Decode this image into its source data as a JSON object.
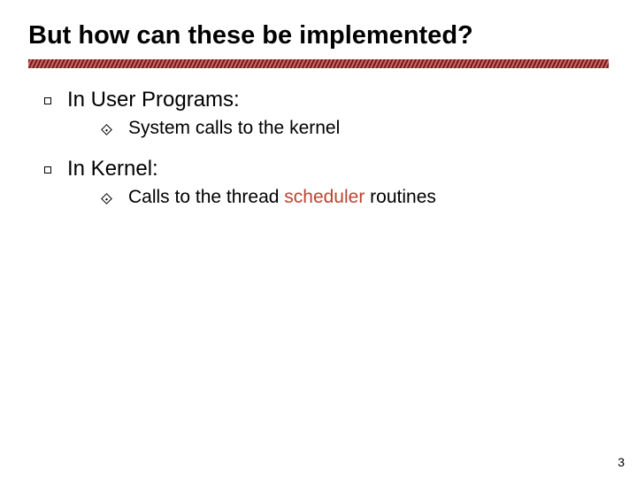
{
  "title": "But how can these be implemented?",
  "items": [
    {
      "label": "In User Programs:",
      "children": [
        {
          "text": "System calls to the kernel"
        }
      ]
    },
    {
      "label": "In Kernel:",
      "children": [
        {
          "prefix": " Calls to the thread ",
          "highlight": "scheduler",
          "suffix": " routines"
        }
      ]
    }
  ],
  "page_number": "3"
}
